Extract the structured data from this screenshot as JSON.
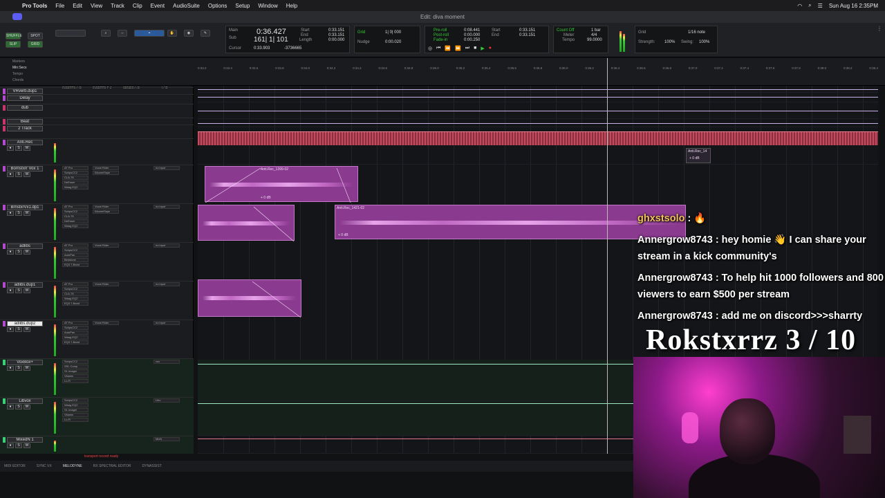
{
  "menubar": {
    "app": "Pro Tools",
    "items": [
      "File",
      "Edit",
      "View",
      "Track",
      "Clip",
      "Event",
      "AudioSuite",
      "Options",
      "Setup",
      "Window",
      "Help"
    ],
    "clock": "Sun Aug 16  2:35PM"
  },
  "title": "Edit: diva moment",
  "toolbar": {
    "modes": [
      "SHUFFLE",
      "SPOT",
      "SLIP",
      "GRID"
    ],
    "main_label": "Main",
    "sub_label": "Sub",
    "main_counter": "0:36.427",
    "sub_counter": "161| 1| 101",
    "cursor_label": "Cursor",
    "cursor_value": "0:33.903",
    "cursor_bars": "-3736665",
    "start_label": "Start",
    "end_label": "End",
    "length_label": "Length",
    "start": "0:33.151",
    "end": "0:33.151",
    "length": "0:00.000",
    "grid_label": "Grid",
    "grid_value": "1| 0| 000",
    "nudge_label": "Nudge",
    "nudge_value": "0:00.020",
    "preroll_label": "Pre-roll",
    "postroll_label": "Post-roll",
    "fadein_label": "Fade-in",
    "preroll": "0:08.441",
    "postroll": "0:00.000",
    "fadein": "0:00.250",
    "t_start": "0:33.151",
    "t_end": "0:33.151",
    "countoff_label": "Count Off",
    "meter_label": "Meter",
    "tempo_label": "Tempo",
    "countoff": "1 bar",
    "meter": "4/4",
    "tempo": "99.0000",
    "grid_note": "1/16 note",
    "strength_label": "Strength:",
    "strength": "100%",
    "swing_label": "Swing:",
    "swing": "100%"
  },
  "rulers": [
    "Markers",
    "Min:Secs",
    "Tempo",
    "Chords"
  ],
  "ruler_ticks": [
    "0:33.2",
    "0:33.4",
    "0:33.6",
    "0:33.8",
    "0:34.0",
    "0:34.2",
    "0:34.4",
    "0:34.6",
    "0:34.8",
    "0:35.0",
    "0:35.2",
    "0:35.4",
    "0:35.6",
    "0:35.8",
    "0:36.0",
    "0:36.2",
    "0:36.4",
    "0:36.6",
    "0:36.8",
    "0:37.0",
    "0:37.2",
    "0:37.4",
    "0:37.6",
    "0:37.8",
    "0:38.0",
    "0:38.2",
    "0:38.4"
  ],
  "mix_headers": [
    "INSERTS A-E",
    "INSERTS F-J",
    "SENDS A-E",
    "I / O"
  ],
  "tracks": [
    {
      "name": "VRverb.dup1",
      "color": "#b04bd0"
    },
    {
      "name": "Delay",
      "color": "#b04bd0"
    },
    {
      "name": "dub",
      "color": "#c8376b"
    },
    {
      "name": "Beat",
      "color": "#c8376b"
    },
    {
      "name": "2 Track",
      "color": "#c8376b"
    },
    {
      "name": "Anti.Rec",
      "color": "#b04bd0"
    },
    {
      "name": "Bornstxrr Vox 1",
      "color": "#b04bd0",
      "inserts": [
        "AT Pro",
        "SchpsCC2",
        "CLA-76",
        "DeEsser",
        "Waag EQ2"
      ],
      "inserts2": [
        "Vocal Rider",
        "KilometTape"
      ],
      "io": "no input"
    },
    {
      "name": "BrnstxrVx1.dp1",
      "color": "#b04bd0",
      "inserts": [
        "AT Pro",
        "SchpsCC2",
        "CLA-76",
        "DeEsser",
        "Waag EQ2"
      ],
      "inserts2": [
        "Vocal Rider",
        "KilometTape"
      ],
      "io": "no input"
    },
    {
      "name": "adlibs",
      "color": "#b04bd0",
      "inserts": [
        "AT Pro",
        "SchpsCC2",
        "AutoPan",
        "Birdstone",
        "EQ3 7-Band"
      ],
      "inserts2": [
        "Vocal Rider"
      ],
      "io": "no input"
    },
    {
      "name": "adlibs.dup1",
      "color": "#b04bd0",
      "inserts": [
        "AT Pro",
        "SchpsCC2",
        "CLA-76",
        "Waag EQ2",
        "EQ3 7-Band"
      ],
      "inserts2": [
        "Vocal Rider"
      ],
      "io": "no input"
    },
    {
      "name": "adlibs.dup2",
      "color": "#b04bd0",
      "inserts": [
        "AT Pro",
        "SchpsCC2",
        "AutoPan",
        "Waag EQ2",
        "EQ3 7-Band"
      ],
      "inserts2": [
        "Vocal Rider"
      ],
      "io": "no input",
      "selected": true
    },
    {
      "name": "VoxBox+",
      "color": "#3ad07a",
      "inserts": [
        "SchpsCC2",
        "SSL Comp",
        "S1 Imager",
        "Vitamin",
        "Lo-Fi"
      ],
      "io": "vox"
    },
    {
      "name": "Libvox",
      "color": "#3ad07a",
      "inserts": [
        "SchpsCC2",
        "Waag EQ2",
        "S1 Imager",
        "Vitamin",
        "Lo-Fi"
      ],
      "io": "Libv"
    },
    {
      "name": "MixedN 1",
      "color": "#3ad07a",
      "io": "MixN"
    }
  ],
  "clips": [
    {
      "name": "Anti.Rec_1399-02",
      "gain": "+ 0 dB"
    },
    {
      "name": "Anti.Rec_1421-02",
      "gain": "+ 0 dB"
    },
    {
      "name": "Anti.Rec_14",
      "gain": "+ 0 dB"
    }
  ],
  "chat": [
    {
      "user": "ghxstsolo",
      "text": " : 🔥"
    },
    {
      "user": "Annergrow8743",
      "text": " : hey homie 👋 I can share your stream in a kick community's"
    },
    {
      "user": "Annergrow8743",
      "text": " : To help hit 1000 followers and 800 viewers to earn $500 per stream"
    },
    {
      "user": "Annergrow8743",
      "text": " : add me on discord>>>sharrty"
    }
  ],
  "goal": "Rokstxrrz 3 / 10",
  "status": "transport record ready",
  "bottom_tabs": [
    "MIDI EDITOR",
    "SYNC VX",
    "MELODYNE",
    "RX SPECTRAL EDITOR",
    "DYNASSIST"
  ]
}
